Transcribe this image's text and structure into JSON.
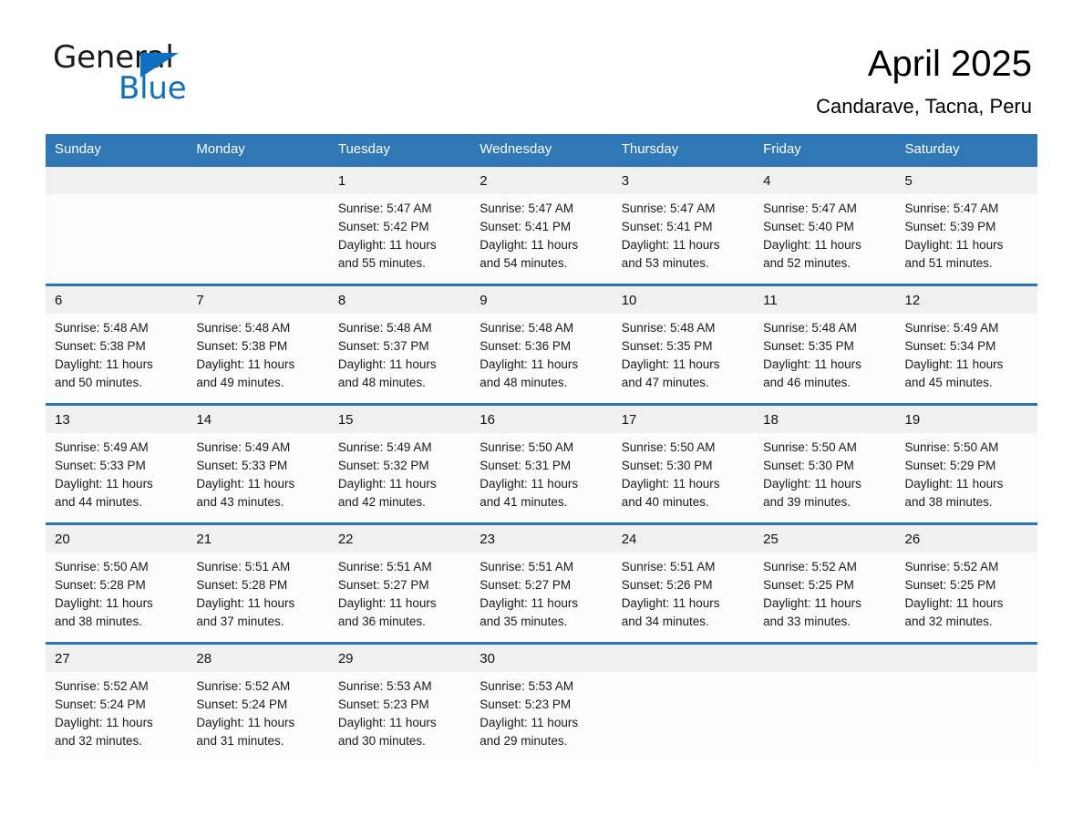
{
  "logo": {
    "word1": "General",
    "word2": "Blue",
    "triangle_color": "#0f6fc1"
  },
  "header": {
    "title": "April 2025",
    "subtitle": "Candarave, Tacna, Peru"
  },
  "theme": {
    "header_blue": "#3077b5",
    "rule_blue": "#2e74b5",
    "date_band": "#f0f0f0",
    "cell_bg": "#fcfcfd"
  },
  "weekdays": [
    "Sunday",
    "Monday",
    "Tuesday",
    "Wednesday",
    "Thursday",
    "Friday",
    "Saturday"
  ],
  "weeks": [
    [
      {
        "day": "",
        "lines": []
      },
      {
        "day": "",
        "lines": []
      },
      {
        "day": "1",
        "lines": [
          "Sunrise: 5:47 AM",
          "Sunset: 5:42 PM",
          "Daylight: 11 hours",
          "and 55 minutes."
        ]
      },
      {
        "day": "2",
        "lines": [
          "Sunrise: 5:47 AM",
          "Sunset: 5:41 PM",
          "Daylight: 11 hours",
          "and 54 minutes."
        ]
      },
      {
        "day": "3",
        "lines": [
          "Sunrise: 5:47 AM",
          "Sunset: 5:41 PM",
          "Daylight: 11 hours",
          "and 53 minutes."
        ]
      },
      {
        "day": "4",
        "lines": [
          "Sunrise: 5:47 AM",
          "Sunset: 5:40 PM",
          "Daylight: 11 hours",
          "and 52 minutes."
        ]
      },
      {
        "day": "5",
        "lines": [
          "Sunrise: 5:47 AM",
          "Sunset: 5:39 PM",
          "Daylight: 11 hours",
          "and 51 minutes."
        ]
      }
    ],
    [
      {
        "day": "6",
        "lines": [
          "Sunrise: 5:48 AM",
          "Sunset: 5:38 PM",
          "Daylight: 11 hours",
          "and 50 minutes."
        ]
      },
      {
        "day": "7",
        "lines": [
          "Sunrise: 5:48 AM",
          "Sunset: 5:38 PM",
          "Daylight: 11 hours",
          "and 49 minutes."
        ]
      },
      {
        "day": "8",
        "lines": [
          "Sunrise: 5:48 AM",
          "Sunset: 5:37 PM",
          "Daylight: 11 hours",
          "and 48 minutes."
        ]
      },
      {
        "day": "9",
        "lines": [
          "Sunrise: 5:48 AM",
          "Sunset: 5:36 PM",
          "Daylight: 11 hours",
          "and 48 minutes."
        ]
      },
      {
        "day": "10",
        "lines": [
          "Sunrise: 5:48 AM",
          "Sunset: 5:35 PM",
          "Daylight: 11 hours",
          "and 47 minutes."
        ]
      },
      {
        "day": "11",
        "lines": [
          "Sunrise: 5:48 AM",
          "Sunset: 5:35 PM",
          "Daylight: 11 hours",
          "and 46 minutes."
        ]
      },
      {
        "day": "12",
        "lines": [
          "Sunrise: 5:49 AM",
          "Sunset: 5:34 PM",
          "Daylight: 11 hours",
          "and 45 minutes."
        ]
      }
    ],
    [
      {
        "day": "13",
        "lines": [
          "Sunrise: 5:49 AM",
          "Sunset: 5:33 PM",
          "Daylight: 11 hours",
          "and 44 minutes."
        ]
      },
      {
        "day": "14",
        "lines": [
          "Sunrise: 5:49 AM",
          "Sunset: 5:33 PM",
          "Daylight: 11 hours",
          "and 43 minutes."
        ]
      },
      {
        "day": "15",
        "lines": [
          "Sunrise: 5:49 AM",
          "Sunset: 5:32 PM",
          "Daylight: 11 hours",
          "and 42 minutes."
        ]
      },
      {
        "day": "16",
        "lines": [
          "Sunrise: 5:50 AM",
          "Sunset: 5:31 PM",
          "Daylight: 11 hours",
          "and 41 minutes."
        ]
      },
      {
        "day": "17",
        "lines": [
          "Sunrise: 5:50 AM",
          "Sunset: 5:30 PM",
          "Daylight: 11 hours",
          "and 40 minutes."
        ]
      },
      {
        "day": "18",
        "lines": [
          "Sunrise: 5:50 AM",
          "Sunset: 5:30 PM",
          "Daylight: 11 hours",
          "and 39 minutes."
        ]
      },
      {
        "day": "19",
        "lines": [
          "Sunrise: 5:50 AM",
          "Sunset: 5:29 PM",
          "Daylight: 11 hours",
          "and 38 minutes."
        ]
      }
    ],
    [
      {
        "day": "20",
        "lines": [
          "Sunrise: 5:50 AM",
          "Sunset: 5:28 PM",
          "Daylight: 11 hours",
          "and 38 minutes."
        ]
      },
      {
        "day": "21",
        "lines": [
          "Sunrise: 5:51 AM",
          "Sunset: 5:28 PM",
          "Daylight: 11 hours",
          "and 37 minutes."
        ]
      },
      {
        "day": "22",
        "lines": [
          "Sunrise: 5:51 AM",
          "Sunset: 5:27 PM",
          "Daylight: 11 hours",
          "and 36 minutes."
        ]
      },
      {
        "day": "23",
        "lines": [
          "Sunrise: 5:51 AM",
          "Sunset: 5:27 PM",
          "Daylight: 11 hours",
          "and 35 minutes."
        ]
      },
      {
        "day": "24",
        "lines": [
          "Sunrise: 5:51 AM",
          "Sunset: 5:26 PM",
          "Daylight: 11 hours",
          "and 34 minutes."
        ]
      },
      {
        "day": "25",
        "lines": [
          "Sunrise: 5:52 AM",
          "Sunset: 5:25 PM",
          "Daylight: 11 hours",
          "and 33 minutes."
        ]
      },
      {
        "day": "26",
        "lines": [
          "Sunrise: 5:52 AM",
          "Sunset: 5:25 PM",
          "Daylight: 11 hours",
          "and 32 minutes."
        ]
      }
    ],
    [
      {
        "day": "27",
        "lines": [
          "Sunrise: 5:52 AM",
          "Sunset: 5:24 PM",
          "Daylight: 11 hours",
          "and 32 minutes."
        ]
      },
      {
        "day": "28",
        "lines": [
          "Sunrise: 5:52 AM",
          "Sunset: 5:24 PM",
          "Daylight: 11 hours",
          "and 31 minutes."
        ]
      },
      {
        "day": "29",
        "lines": [
          "Sunrise: 5:53 AM",
          "Sunset: 5:23 PM",
          "Daylight: 11 hours",
          "and 30 minutes."
        ]
      },
      {
        "day": "30",
        "lines": [
          "Sunrise: 5:53 AM",
          "Sunset: 5:23 PM",
          "Daylight: 11 hours",
          "and 29 minutes."
        ]
      },
      {
        "day": "",
        "lines": []
      },
      {
        "day": "",
        "lines": []
      },
      {
        "day": "",
        "lines": []
      }
    ]
  ]
}
